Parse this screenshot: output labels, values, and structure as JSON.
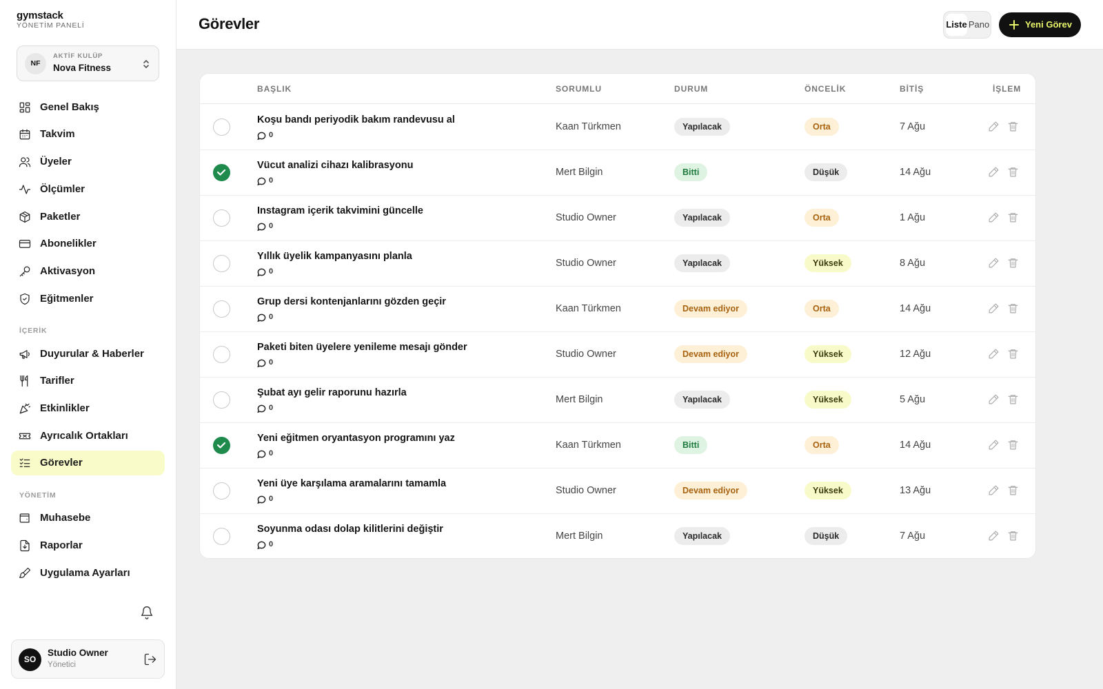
{
  "brand": {
    "name": "gymstack",
    "subtitle": "YÖNETİM PANELİ"
  },
  "club": {
    "initials": "NF",
    "caption": "AKTİF KULÜP",
    "name": "Nova Fitness",
    "icon": "chevron-up-down-icon"
  },
  "sidebar": {
    "items": [
      {
        "label": "Genel Bakış",
        "icon": "grid-icon"
      },
      {
        "label": "Takvim",
        "icon": "calendar-icon"
      },
      {
        "label": "Üyeler",
        "icon": "users-icon"
      },
      {
        "label": "Ölçümler",
        "icon": "activity-icon"
      },
      {
        "label": "Paketler",
        "icon": "package-icon"
      },
      {
        "label": "Abonelikler",
        "icon": "credit-card-icon"
      },
      {
        "label": "Aktivasyon",
        "icon": "key-icon"
      },
      {
        "label": "Eğitmenler",
        "icon": "shield-icon"
      }
    ],
    "content_section": "İÇERİK",
    "content_items": [
      {
        "label": "Duyurular & Haberler",
        "icon": "megaphone-icon"
      },
      {
        "label": "Tarifler",
        "icon": "utensils-icon"
      },
      {
        "label": "Etkinlikler",
        "icon": "party-popper-icon"
      },
      {
        "label": "Ayrıcalık Ortakları",
        "icon": "ticket-icon"
      },
      {
        "label": "Görevler",
        "icon": "list-checks-icon",
        "active": true
      }
    ],
    "management_section": "YÖNETİM",
    "management_items": [
      {
        "label": "Muhasebe",
        "icon": "wallet-icon"
      },
      {
        "label": "Raporlar",
        "icon": "file-report-icon"
      },
      {
        "label": "Uygulama Ayarları",
        "icon": "paintbrush-icon"
      }
    ]
  },
  "user": {
    "initials": "SO",
    "name": "Studio Owner",
    "role": "Yönetici"
  },
  "header": {
    "title": "Görevler",
    "view_list": "Liste",
    "view_board": "Pano",
    "new_task": "Yeni Görev"
  },
  "table": {
    "columns": {
      "title": "BAŞLIK",
      "assignee": "SORUMLU",
      "status": "DURUM",
      "priority": "ÖNCELİK",
      "due": "BİTİŞ",
      "actions": "İŞLEM"
    },
    "rows": [
      {
        "done": false,
        "title": "Koşu bandı periyodik bakım randevusu al",
        "comments": "0",
        "assignee": "Kaan Türkmen",
        "status": "Yapılacak",
        "priority": "Orta",
        "due": "7 Ağu"
      },
      {
        "done": true,
        "title": "Vücut analizi cihazı kalibrasyonu",
        "comments": "0",
        "assignee": "Mert Bilgin",
        "status": "Bitti",
        "priority": "Düşük",
        "due": "14 Ağu"
      },
      {
        "done": false,
        "title": "Instagram içerik takvimini güncelle",
        "comments": "0",
        "assignee": "Studio Owner",
        "status": "Yapılacak",
        "priority": "Orta",
        "due": "1 Ağu"
      },
      {
        "done": false,
        "title": "Yıllık üyelik kampanyasını planla",
        "comments": "0",
        "assignee": "Studio Owner",
        "status": "Yapılacak",
        "priority": "Yüksek",
        "due": "8 Ağu"
      },
      {
        "done": false,
        "title": "Grup dersi kontenjanlarını gözden geçir",
        "comments": "0",
        "assignee": "Kaan Türkmen",
        "status": "Devam ediyor",
        "priority": "Orta",
        "due": "14 Ağu"
      },
      {
        "done": false,
        "title": "Paketi biten üyelere yenileme mesajı gönder",
        "comments": "0",
        "assignee": "Studio Owner",
        "status": "Devam ediyor",
        "priority": "Yüksek",
        "due": "12 Ağu"
      },
      {
        "done": false,
        "title": "Şubat ayı gelir raporunu hazırla",
        "comments": "0",
        "assignee": "Mert Bilgin",
        "status": "Yapılacak",
        "priority": "Yüksek",
        "due": "5 Ağu"
      },
      {
        "done": true,
        "title": "Yeni eğitmen oryantasyon programını yaz",
        "comments": "0",
        "assignee": "Kaan Türkmen",
        "status": "Bitti",
        "priority": "Orta",
        "due": "14 Ağu"
      },
      {
        "done": false,
        "title": "Yeni üye karşılama aramalarını tamamla",
        "comments": "0",
        "assignee": "Studio Owner",
        "status": "Devam ediyor",
        "priority": "Yüksek",
        "due": "13 Ağu"
      },
      {
        "done": false,
        "title": "Soyunma odası dolap kilitlerini değiştir",
        "comments": "0",
        "assignee": "Mert Bilgin",
        "status": "Yapılacak",
        "priority": "Düşük",
        "due": "7 Ağu"
      }
    ]
  },
  "colors": {
    "accent": "#f9fbc9",
    "button_bg": "#111111",
    "button_text": "#e9f56a",
    "done_check": "#1e8a4c",
    "status_todo_bg": "#ececec",
    "status_done_bg": "#dff3e3",
    "status_progress_bg": "#fdf0d6",
    "priority_high_bg": "#f8fbc9"
  }
}
